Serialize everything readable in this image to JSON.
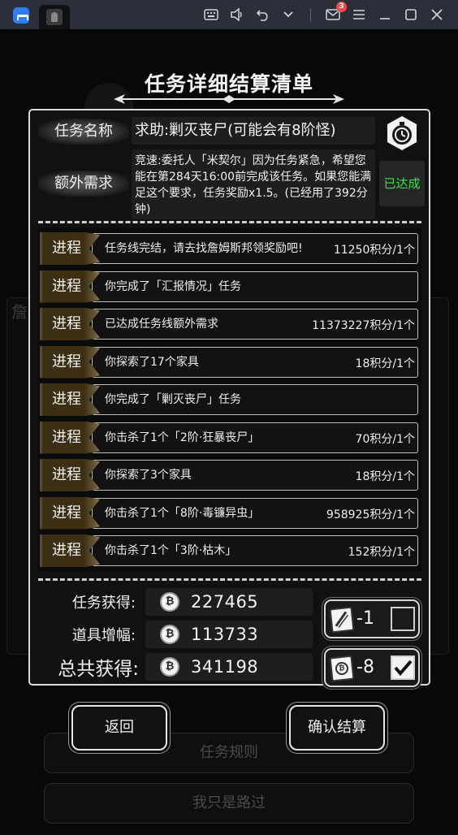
{
  "topbar": {
    "app_icon": "multi-app-logo-icon",
    "tab_icon": "game-tab-icon",
    "mail_badge": "3",
    "icons": [
      "keyboard-icon",
      "volume-icon",
      "undo-icon",
      "chevron-down-icon",
      "mail-icon",
      "menu-icon",
      "minimize-icon",
      "maximize-icon",
      "close-icon"
    ]
  },
  "background": {
    "side_char": "詹",
    "rule_button": "任务规则",
    "pass_button": "我只是路过"
  },
  "title": "任务详细结算清单",
  "quest": {
    "name_label": "任务名称",
    "name_value": "求助:剿灭丧尸(可能会有8阶怪)",
    "extra_label": "额外需求",
    "extra_value": "竞速:委托人「米契尔」因为任务紧急，希望您能在第284天16:00前完成该任务。如果您能满足这个要求，任务奖励x1.5。(已经用了392分钟)",
    "status": "已达成",
    "status_color": "#3ee04d",
    "timer_icon": "stopwatch-icon"
  },
  "progress": {
    "tag": "进程",
    "rows": [
      {
        "text": "任务线完结，请去找詹姆斯邦领奖励吧!",
        "value": "11250积分/1个"
      },
      {
        "text": "你完成了「汇报情况」任务",
        "value": ""
      },
      {
        "text": "已达成任务线额外需求",
        "value": "11373227积分/1个"
      },
      {
        "text": "你探索了17个家具",
        "value": "18积分/1个"
      },
      {
        "text": "你完成了「剿灭丧尸」任务",
        "value": ""
      },
      {
        "text": "你击杀了1个「2阶·狂暴丧尸」",
        "value": "70积分/1个"
      },
      {
        "text": "你探索了3个家具",
        "value": "18积分/1个"
      },
      {
        "text": "你击杀了1个「8阶·毒镰异虫」",
        "value": "958925积分/1个"
      },
      {
        "text": "你击杀了1个「3阶·枯木」",
        "value": "152积分/1个"
      }
    ]
  },
  "totals": {
    "task_label": "任务获得:",
    "task_value": "227465",
    "bonus_label": "道具增幅:",
    "bonus_value": "113733",
    "total_label": "总共获得:",
    "total_value": "341198",
    "coin_glyph": "₿"
  },
  "items": [
    {
      "icon": "scroll-item-icon",
      "count": "-1",
      "checked": false
    },
    {
      "icon": "coin-card-item-icon",
      "count": "-8",
      "checked": true
    }
  ],
  "actions": {
    "back": "返回",
    "confirm": "确认结算"
  }
}
